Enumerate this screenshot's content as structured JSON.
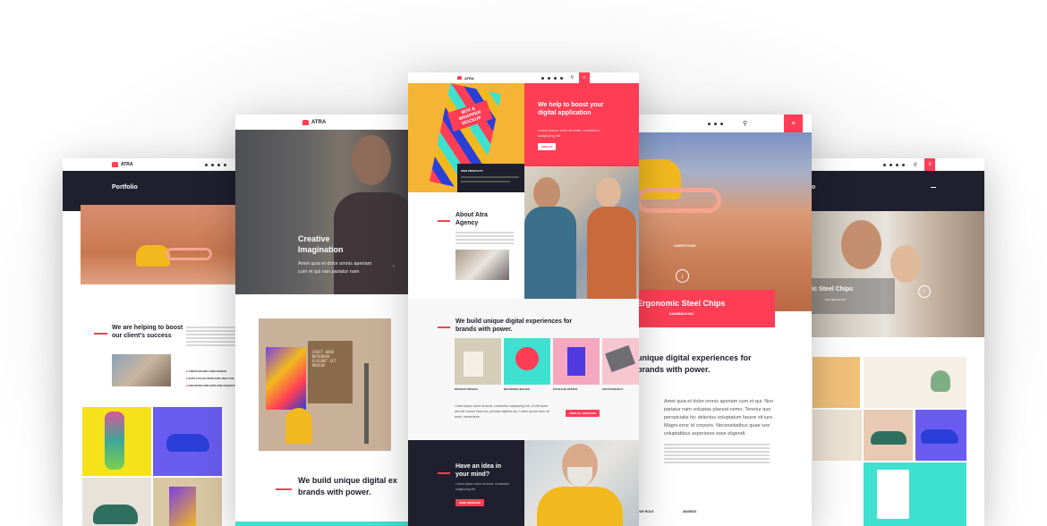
{
  "brand": {
    "logo_text": "ATRA",
    "accent": "#ff3d55",
    "dark": "#1f1f2e"
  },
  "far_left": {
    "title": "Portfolio",
    "helping_title": "We are helping to boost our client's success",
    "services": [
      "CREATIVE IDEA AND DESIGN",
      "DATA COLLECTION AND ANALYSIS",
      "DISCOVER AND EXPLORE REQUEST"
    ]
  },
  "left": {
    "hero_title": "Creative Imagination",
    "hero_text": "Amet quia et dolor omnis aperiam cum et qui non pariatur nam",
    "box_label": "CRAFT WOOD NOTEBOOK ELEGANT SET MOCKUP",
    "build_title": "We build unique digital ex brands with power."
  },
  "center": {
    "hero_title": "We help to boost your digital application",
    "hero_text": "Lorem ipsum dolor sit amet, consetetur sadipscing elit",
    "hero_button": "SIGN UP",
    "product_text": "BOX & WRAPPER MOCKUP",
    "web_products_label": "WEB PRODUCTS",
    "about_title": "About Atra Agency",
    "build_title": "We build unique digital experiences for brands with power.",
    "gallery_captions": [
      "MOCKUP DESIGN",
      "BRANDING IMAGES",
      "PACKAGE DESIGN",
      "PHOTOGRAPHY"
    ],
    "body_text": "Lorem ipsum dolor sit amet, consetetur sadipscing elit. Ut elit lorem sed vel nonum moto mo, pulvinar dapibus leo. Lorem ipsum dolor sit amet, consectetur",
    "learn_button": "VIEW ALL SERVICES",
    "idea_title": "Have an idea in your mind?",
    "idea_text": "Lorem ipsum dolor sit amet, consetetur sadipscing elit",
    "idea_button": "SEND MESSAGE"
  },
  "right": {
    "case_study": "CASES STUDY",
    "product_title": "Ergonomic Steel Chips",
    "product_sub": "DAUNBACH INC",
    "build_title": "unique digital experiences for brands with power.",
    "body_text": "Amet quia et dolor omnis aperiam cum et qui. Non pariatur nam voluptas placeat nemo. Tenetur quo perspiciatis hic delectus voluptatum facere sit iure. Magni error id corporis. Necessitatibus quae iure voluptatibus asperiores esse eligendi.",
    "col_a": "OUR ROLE",
    "col_b": "AWARDS"
  },
  "far_right": {
    "title": "io",
    "product_title": "nic Steel Chips",
    "product_sub": "DAUNBACH INC"
  }
}
